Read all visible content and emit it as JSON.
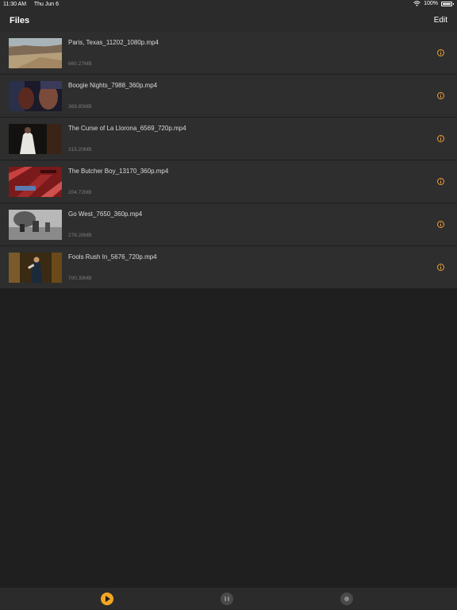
{
  "status_bar": {
    "time": "11:30 AM",
    "date": "Thu Jun 6",
    "battery": "100%"
  },
  "nav": {
    "title": "Files",
    "edit_label": "Edit"
  },
  "files": [
    {
      "name": "Paris, Texas_11202_1080p.mp4",
      "size": "660.27MB"
    },
    {
      "name": "Boogie Nights_7988_360p.mp4",
      "size": "369.85MB"
    },
    {
      "name": "The Curse of La Llorona_6569_720p.mp4",
      "size": "315.20MB"
    },
    {
      "name": "The Butcher Boy_13170_360p.mp4",
      "size": "204.72MB"
    },
    {
      "name": "Go West_7650_360p.mp4",
      "size": "278.26MB"
    },
    {
      "name": "Fools Rush In_5676_720p.mp4",
      "size": "700.39MB"
    }
  ],
  "tabs": [
    {
      "name": "video-tab",
      "icon": "play-icon",
      "active": true
    },
    {
      "name": "audio-tab",
      "icon": "audio-icon",
      "active": false
    },
    {
      "name": "settings-tab",
      "icon": "settings-icon",
      "active": false
    }
  ],
  "colors": {
    "accent": "#f5a623",
    "background": "#1f1f1f",
    "row": "#2e2e2e"
  }
}
